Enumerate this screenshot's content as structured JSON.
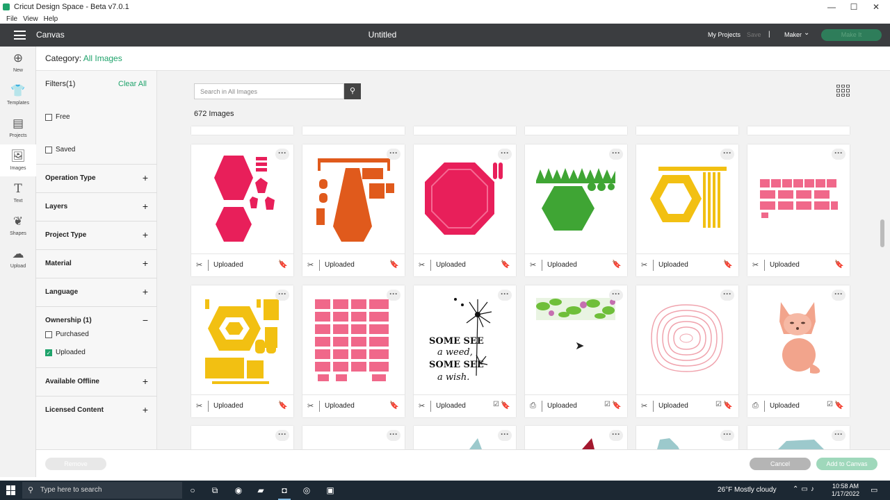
{
  "window": {
    "title": "Cricut Design Space - Beta v7.0.1",
    "minimize": "—",
    "maximize": "☐",
    "close": "✕"
  },
  "menu": [
    "File",
    "View",
    "Help"
  ],
  "header": {
    "section": "Canvas",
    "doc_title": "Untitled",
    "my_projects": "My Projects",
    "save": "Save",
    "separator": "|",
    "machine": "Maker",
    "make_it": "Make It"
  },
  "leftnav": [
    {
      "label": "New",
      "icon": "plus-circle-icon"
    },
    {
      "label": "Templates",
      "icon": "shirt-icon"
    },
    {
      "label": "Projects",
      "icon": "projects-icon"
    },
    {
      "label": "Images",
      "icon": "images-icon"
    },
    {
      "label": "Text",
      "icon": "text-icon"
    },
    {
      "label": "Shapes",
      "icon": "shapes-icon"
    },
    {
      "label": "Upload",
      "icon": "upload-icon"
    }
  ],
  "category": {
    "prefix": "Category:",
    "value": "All Images"
  },
  "filters": {
    "title": "Filters(1)",
    "clear": "Clear All",
    "free": "Free",
    "saved": "Saved",
    "sections": [
      "Operation Type",
      "Layers",
      "Project Type",
      "Material",
      "Language"
    ],
    "ownership": {
      "title": "Ownership (1)",
      "toggle": "−",
      "options": [
        {
          "label": "Purchased",
          "checked": false
        },
        {
          "label": "Uploaded",
          "checked": true
        }
      ]
    },
    "after": [
      "Available Offline",
      "Licensed Content"
    ],
    "plus": "+"
  },
  "search": {
    "placeholder": "Search in All Images"
  },
  "result_count": "672 Images",
  "card_label": "Uploaded",
  "cards": [
    {
      "art": "pink-hexagons",
      "op": "cut"
    },
    {
      "art": "orange-house",
      "op": "cut"
    },
    {
      "art": "pink-octagon",
      "op": "cut"
    },
    {
      "art": "green-hexagon",
      "op": "cut"
    },
    {
      "art": "yellow-hexagon",
      "op": "cut"
    },
    {
      "art": "pink-pieces",
      "op": "cut"
    },
    {
      "art": "yellow-house",
      "op": "cut"
    },
    {
      "art": "pink-house-pieces",
      "op": "cut"
    },
    {
      "art": "dandelion",
      "op": "cut",
      "placed": true,
      "text": [
        "SOME SEE",
        "a weed,",
        "SOME SEE",
        "a wish."
      ]
    },
    {
      "art": "leaf-banner",
      "op": "print",
      "placed": true
    },
    {
      "art": "pink-swirl",
      "op": "cut",
      "placed": true
    },
    {
      "art": "fox",
      "op": "print",
      "placed": true
    }
  ],
  "footer": {
    "remove": "Remove",
    "cancel": "Cancel",
    "add": "Add to Canvas"
  },
  "taskbar": {
    "search": "Type here to search",
    "weather": "26°F  Mostly cloudy",
    "time": "10:58 AM",
    "date": "1/17/2022"
  }
}
